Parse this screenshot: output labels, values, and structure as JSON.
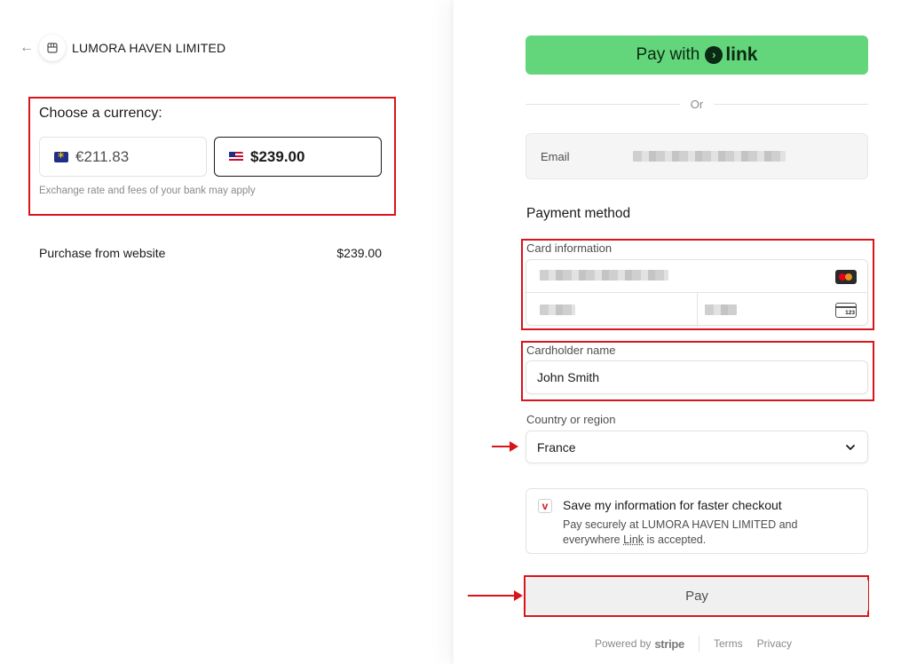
{
  "merchant": {
    "name": "LUMORA HAVEN LIMITED"
  },
  "currency": {
    "title": "Choose a currency:",
    "options": [
      {
        "label": "€211.83",
        "flag": "eu-flag-icon",
        "selected": false
      },
      {
        "label": "$239.00",
        "flag": "us-flag-icon",
        "selected": true
      }
    ],
    "note": "Exchange rate and fees of your bank may apply"
  },
  "summary": {
    "line_label": "Purchase from website",
    "line_value": "$239.00"
  },
  "link_button": {
    "prefix": "Pay with",
    "brand": "link"
  },
  "separator": {
    "or_text": "Or"
  },
  "email": {
    "label": "Email"
  },
  "payment": {
    "title": "Payment method",
    "card_label": "Card information",
    "cardholder_label": "Cardholder name",
    "cardholder_value": "John Smith",
    "country_label": "Country or region",
    "country_value": "France"
  },
  "save": {
    "checkbox_mark": "v",
    "title": "Save my information for faster checkout",
    "desc_before": "Pay securely at LUMORA HAVEN LIMITED and everywhere ",
    "desc_link": "Link",
    "desc_after": " is accepted."
  },
  "pay_button": {
    "label": "Pay"
  },
  "footer": {
    "powered_by": "Powered by",
    "brand": "stripe",
    "terms": "Terms",
    "privacy": "Privacy"
  },
  "colors": {
    "link_green": "#63d57a",
    "highlight_red": "#d9141a",
    "text": "#1a1a1a",
    "muted": "#8a8a8a"
  }
}
